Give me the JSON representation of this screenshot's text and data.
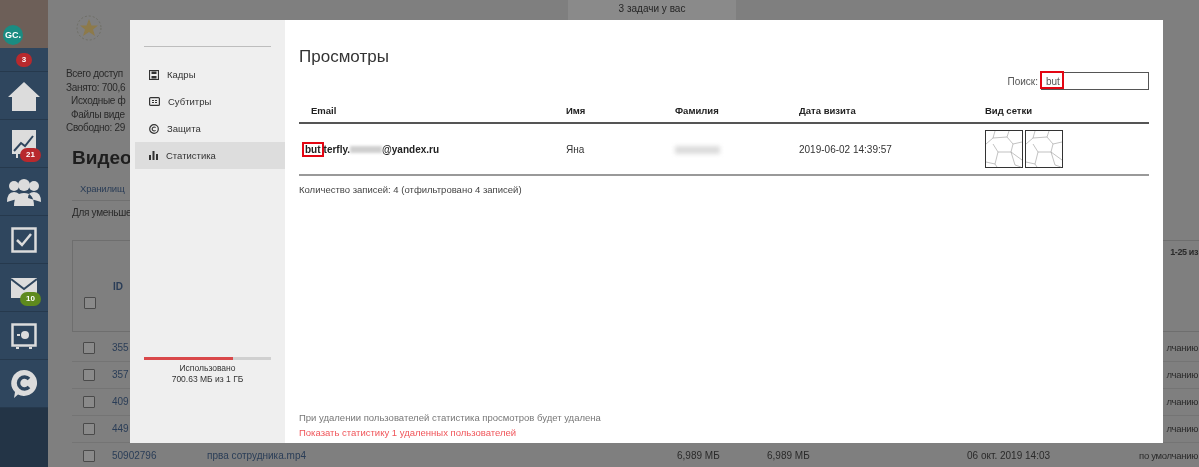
{
  "sidebar": {
    "avatar": {
      "initials": "GC."
    },
    "items": [
      {
        "kind": "counter",
        "badge": "3",
        "color": "#b8292d"
      },
      {
        "kind": "home"
      },
      {
        "kind": "chart",
        "badge": "21",
        "color": "#b8292d"
      },
      {
        "kind": "users"
      },
      {
        "kind": "tasks"
      },
      {
        "kind": "mail",
        "badge": "10",
        "color": "#5e8a1e"
      },
      {
        "kind": "safe"
      },
      {
        "kind": "chat"
      }
    ]
  },
  "background": {
    "tasks_notice": "3 задачи у вас",
    "storage_lines": [
      "Всего доступ",
      "Занято: 700,6",
      "Исходные ф",
      "Файлы виде",
      "Свободно: 29"
    ],
    "heading": "Видео",
    "tab": "Хранилищ",
    "hint": "Для уменьше",
    "pager": "1-25 из",
    "table": {
      "id_header": "ID",
      "header_checked": false,
      "rows": [
        {
          "checked": false,
          "id": "355",
          "preset": "лчанию"
        },
        {
          "checked": false,
          "id": "357",
          "preset": "лчанию"
        },
        {
          "checked": false,
          "id": "409",
          "preset": "лчанию"
        },
        {
          "checked": false,
          "id": "449",
          "preset": "лчанию"
        },
        {
          "checked": false,
          "id": "50902796",
          "name": "прва сотрудника.mp4",
          "size": "6,989 МБ",
          "size_2": "6,989 МБ",
          "date": "06 окт. 2019 14:03",
          "preset": "по умолчанию"
        }
      ]
    }
  },
  "modal": {
    "menu": [
      {
        "label": "Кадры",
        "kind": "film",
        "selected": false
      },
      {
        "label": "Субтитры",
        "kind": "subtitles",
        "selected": false
      },
      {
        "label": "Защита",
        "kind": "copyright",
        "selected": false
      },
      {
        "label": "Статистика",
        "kind": "bars",
        "selected": true
      }
    ],
    "storage": {
      "level": 0.7,
      "label": "Использовано",
      "usage": "700.63 МБ из 1 ГБ"
    },
    "title": "Просмотры",
    "search": {
      "label": "Поиск:",
      "value": "but",
      "highlighted": true
    },
    "table": {
      "columns": [
        "Email",
        "Имя",
        "Фамилия",
        "Дата визита",
        "Вид сетки"
      ],
      "rows": [
        {
          "email": [
            {
              "kind": "text",
              "text": "but",
              "highlighted": true
            },
            {
              "kind": "text",
              "text": "terfly.",
              "highlighted": false
            },
            {
              "kind": "blurred"
            },
            {
              "kind": "text",
              "text": "@yandex.ru",
              "highlighted": false
            }
          ],
          "first_name": "Яна",
          "last_name": {
            "kind": "blurred"
          },
          "visit_date": "2019-06-02 14:39:57",
          "grid_views": [
            {
              "kind": "mesh"
            },
            {
              "kind": "mesh"
            }
          ]
        }
      ]
    },
    "count": "Количество записей: 4 (отфильтровано 4 записей)",
    "note": "При удалении пользователей статистика просмотров будет удалена",
    "link": "Показать статистику 1 удаленных пользователей"
  }
}
